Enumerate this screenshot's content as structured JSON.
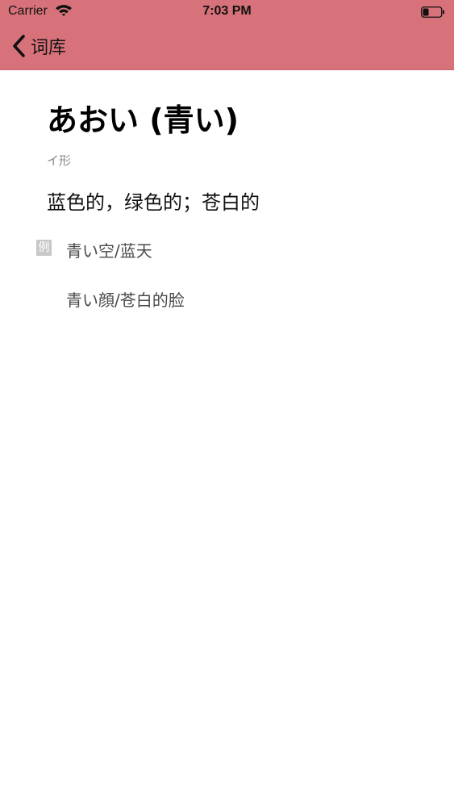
{
  "status_bar": {
    "carrier": "Carrier",
    "time": "7:03 PM"
  },
  "nav": {
    "back_label": "词库"
  },
  "word": {
    "title": "あおい (青い)",
    "type": "イ形",
    "meaning": "蓝色的，绿色的；苍白的",
    "example_badge": "例",
    "examples": [
      "青い空/蓝天",
      "青い顔/苍白的脸"
    ]
  },
  "colors": {
    "header": "#d8727a",
    "badge": "#c8c8c8",
    "type_text": "#8a8a8a"
  }
}
